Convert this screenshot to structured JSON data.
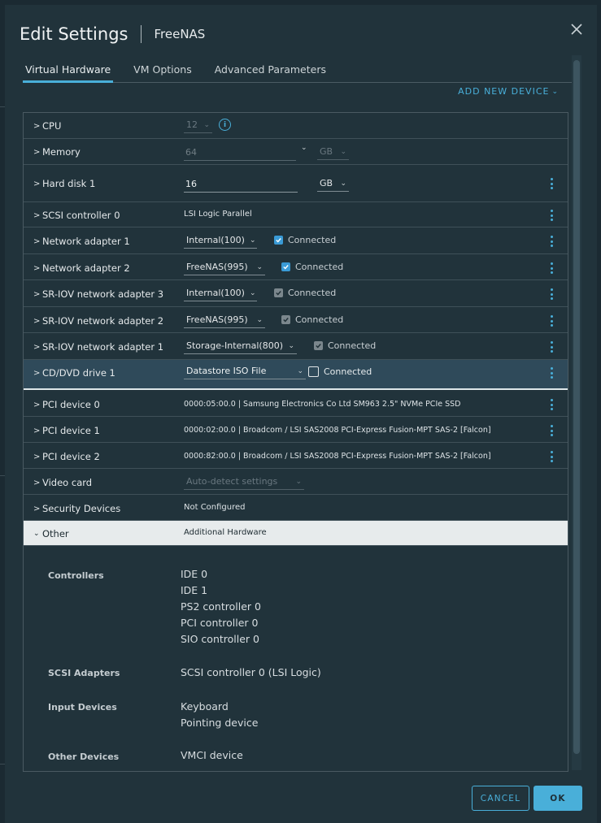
{
  "dialog": {
    "title": "Edit Settings",
    "subtitle": "FreeNAS",
    "close_icon": "close-icon"
  },
  "tabs": [
    {
      "label": "Virtual Hardware",
      "active": true
    },
    {
      "label": "VM Options",
      "active": false
    },
    {
      "label": "Advanced Parameters",
      "active": false
    }
  ],
  "add_device": {
    "label": "ADD NEW DEVICE",
    "icon": "chevron-down-icon"
  },
  "hardware": {
    "cpu": {
      "label": "CPU",
      "value": "12",
      "icon": "info-icon"
    },
    "memory": {
      "label": "Memory",
      "value": "64",
      "unit": "GB"
    },
    "hard_disk_1": {
      "label": "Hard disk 1",
      "value": "16",
      "unit": "GB"
    },
    "scsi_controller_0": {
      "label": "SCSI controller 0",
      "value": "LSI Logic Parallel"
    },
    "network_adapter_1": {
      "label": "Network adapter 1",
      "network": "Internal(100)",
      "connected_label": "Connected",
      "connected": true
    },
    "network_adapter_2": {
      "label": "Network adapter 2",
      "network": "FreeNAS(995)",
      "connected_label": "Connected",
      "connected": true
    },
    "sriov_3": {
      "label": "SR-IOV network adapter 3",
      "network": "Internal(100)",
      "connected_label": "Connected",
      "connected": true
    },
    "sriov_2": {
      "label": "SR-IOV network adapter 2",
      "network": "FreeNAS(995)",
      "connected_label": "Connected",
      "connected": true
    },
    "sriov_1": {
      "label": "SR-IOV network adapter 1",
      "network": "Storage-Internal(800)",
      "connected_label": "Connected",
      "connected": true
    },
    "cd_dvd_1": {
      "label": "CD/DVD drive 1",
      "media": "Datastore ISO File",
      "connected_label": "Connected",
      "connected": false
    },
    "pci_0": {
      "label": "PCI device 0",
      "value": "0000:05:00.0 | Samsung Electronics Co Ltd SM963 2.5\" NVMe PCIe SSD"
    },
    "pci_1": {
      "label": "PCI device 1",
      "value": "0000:02:00.0 | Broadcom / LSI SAS2008 PCI-Express Fusion-MPT SAS-2 [Falcon]"
    },
    "pci_2": {
      "label": "PCI device 2",
      "value": "0000:82:00.0 | Broadcom / LSI SAS2008 PCI-Express Fusion-MPT SAS-2 [Falcon]"
    },
    "video_card": {
      "label": "Video card",
      "value": "Auto-detect settings"
    },
    "security_devices": {
      "label": "Security Devices",
      "value": "Not Configured"
    },
    "other": {
      "label": "Other",
      "value": "Additional Hardware"
    }
  },
  "other_details": {
    "controllers": {
      "label": "Controllers",
      "items": [
        "IDE 0",
        "IDE 1",
        "PS2 controller 0",
        "PCI controller 0",
        "SIO controller 0"
      ]
    },
    "scsi_adapters": {
      "label": "SCSI Adapters",
      "items": [
        "SCSI controller 0 (LSI Logic)"
      ]
    },
    "input_devices": {
      "label": "Input Devices",
      "items": [
        "Keyboard",
        "Pointing device"
      ]
    },
    "other_devices": {
      "label": "Other Devices",
      "items": [
        "VMCI device"
      ]
    }
  },
  "footer": {
    "cancel_label": "CANCEL",
    "ok_label": "OK"
  },
  "colors": {
    "accent": "#49afd9",
    "background": "#21333b",
    "checkbox": "#3a9bd6"
  }
}
